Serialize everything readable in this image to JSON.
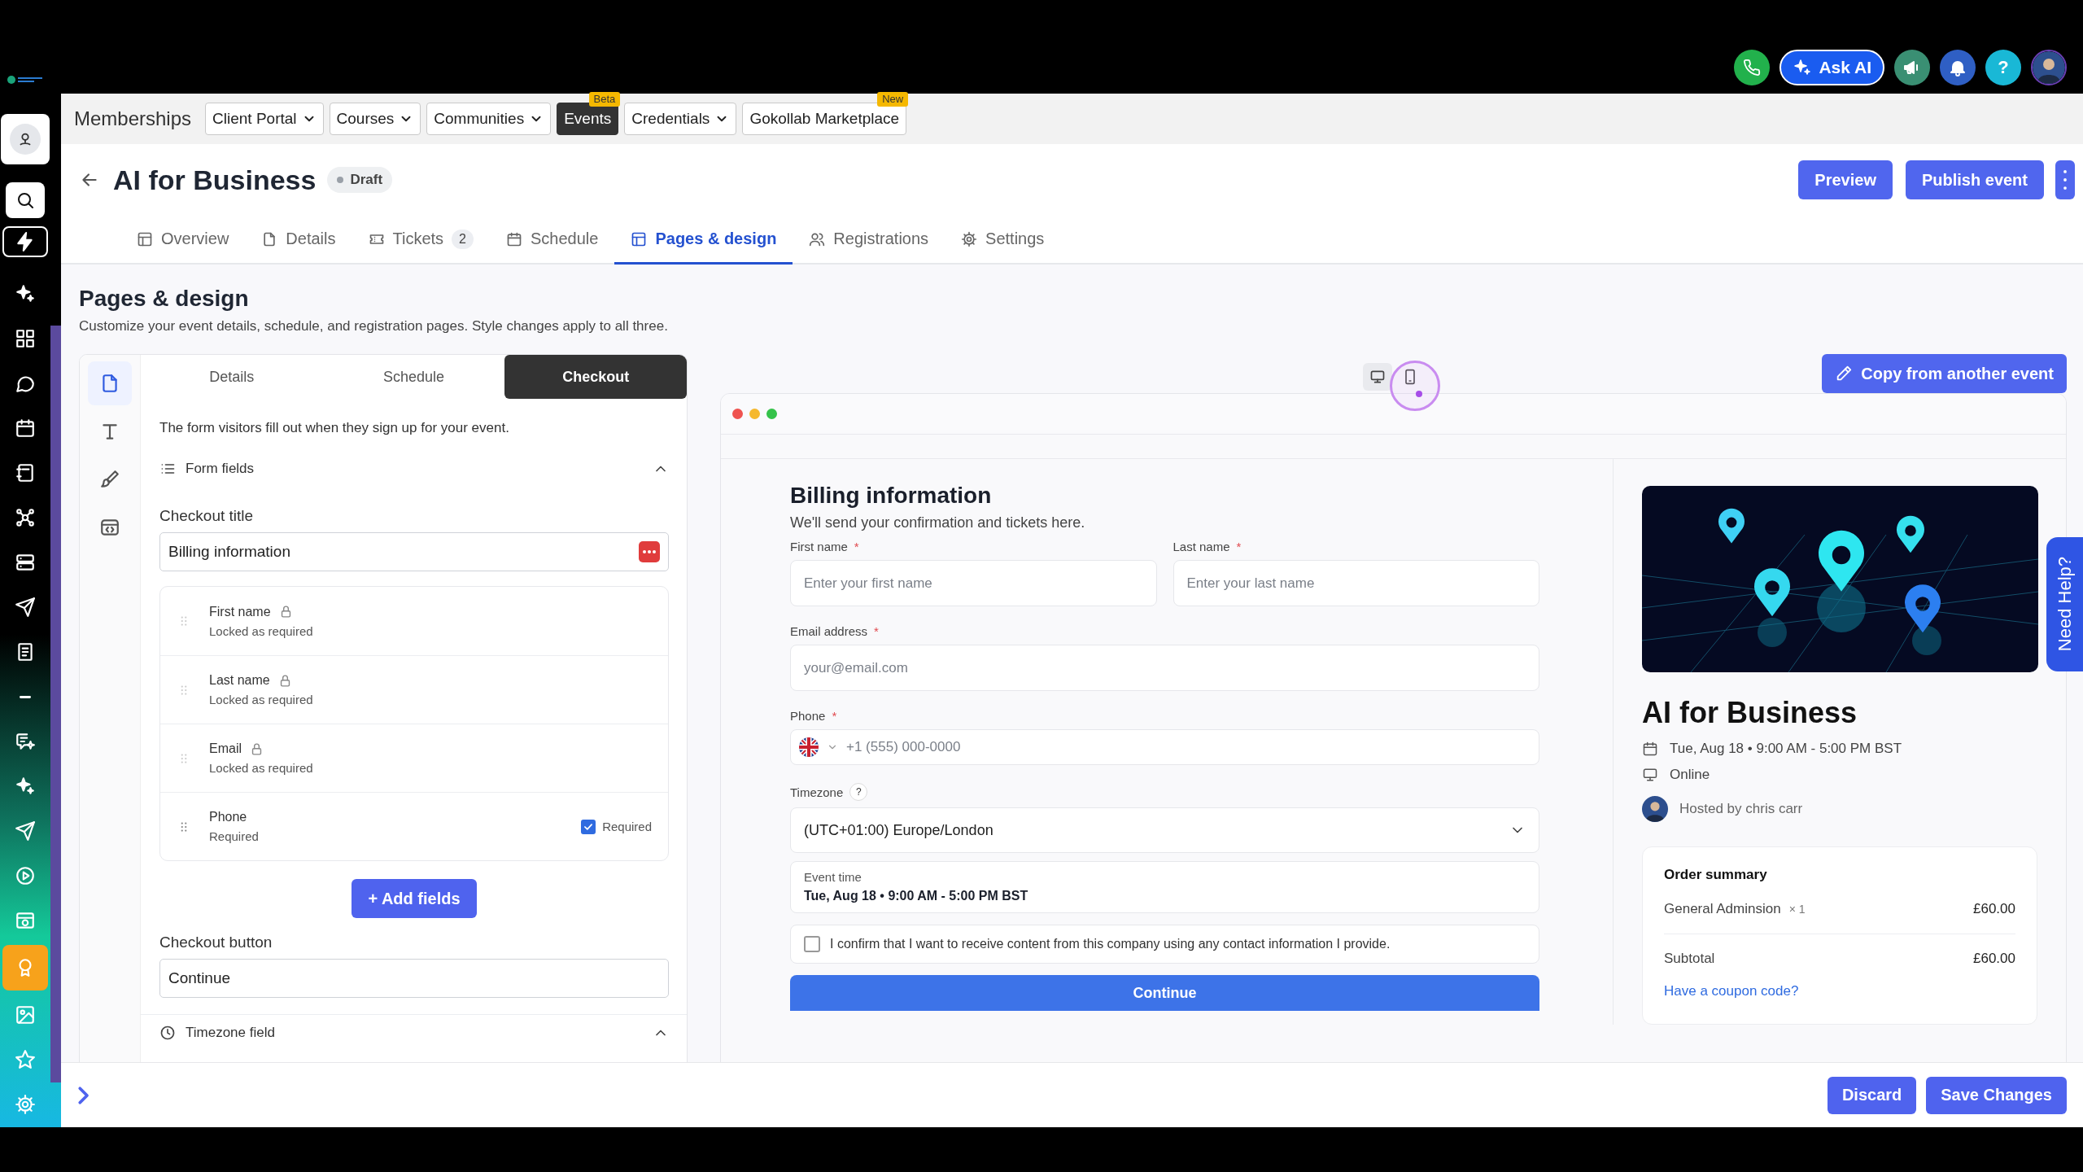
{
  "top_bar": {
    "ask_ai": "Ask AI",
    "help": "?"
  },
  "rail": [
    {
      "selected": false
    },
    {
      "selected": false
    },
    {
      "selected": false
    },
    {
      "selected": false
    },
    {
      "selected": false
    },
    {
      "selected": false
    },
    {
      "selected": false
    },
    {
      "selected": false
    },
    {
      "selected": false
    },
    {
      "selected": false
    },
    {
      "selected": false
    },
    {
      "selected": false
    },
    {
      "selected": false
    },
    {
      "selected": false
    },
    {
      "selected": false
    },
    {
      "selected": false
    },
    {
      "selected": false
    },
    {
      "selected": false
    },
    {
      "selected": true
    },
    {
      "selected": false
    },
    {
      "selected": false
    },
    {
      "selected": false
    }
  ],
  "nav": {
    "title": "Memberships",
    "items": [
      {
        "label": "Client Portal",
        "dropdown": true,
        "selected": false
      },
      {
        "label": "Courses",
        "dropdown": true,
        "selected": false
      },
      {
        "label": "Communities",
        "dropdown": true,
        "selected": false
      },
      {
        "label": "Events",
        "dropdown": false,
        "selected": true,
        "badge": "Beta"
      },
      {
        "label": "Credentials",
        "dropdown": true,
        "selected": false
      },
      {
        "label": "Gokollab Marketplace",
        "dropdown": false,
        "selected": false,
        "badge": "New"
      }
    ]
  },
  "event": {
    "title": "AI for Business",
    "status": "Draft",
    "actions": [
      "Preview",
      "Publish event"
    ]
  },
  "tabs": [
    {
      "label": "Overview",
      "selected": false
    },
    {
      "label": "Details",
      "selected": false
    },
    {
      "label": "Tickets",
      "count": "2",
      "selected": false
    },
    {
      "label": "Schedule",
      "selected": false
    },
    {
      "label": "Pages & design",
      "selected": true
    },
    {
      "label": "Registrations",
      "selected": false
    },
    {
      "label": "Settings",
      "selected": false
    }
  ],
  "section": {
    "title": "Pages & design",
    "subtitle": "Customize your event details, schedule, and registration pages. Style changes apply to all three."
  },
  "editor": {
    "tools": [
      {
        "selected": true
      },
      {
        "selected": false
      },
      {
        "selected": false
      },
      {
        "selected": false
      }
    ],
    "tabs": [
      {
        "label": "Details",
        "selected": false
      },
      {
        "label": "Schedule",
        "selected": false
      },
      {
        "label": "Checkout",
        "selected": true
      }
    ],
    "intro": "The form visitors fill out when they sign up for your event.",
    "form_fields": {
      "title": "Form fields",
      "expanded": true
    },
    "checkout_title": {
      "label": "Checkout title",
      "value": "Billing information"
    },
    "fields": [
      {
        "name": "First name",
        "note": "Locked as required",
        "locked": true
      },
      {
        "name": "Last name",
        "note": "Locked as required",
        "locked": true
      },
      {
        "name": "Email",
        "note": "Locked as required",
        "locked": true
      },
      {
        "name": "Phone",
        "note": "Required",
        "locked": false,
        "required": true,
        "required_label": "Required"
      }
    ],
    "add_fields": "+ Add fields",
    "checkout_button": {
      "label": "Checkout button",
      "value": "Continue"
    },
    "timezone_field": {
      "title": "Timezone field",
      "expanded": true
    }
  },
  "preview": {
    "devices": [
      {
        "selected": true
      },
      {
        "selected": false
      }
    ],
    "copy_button": "Copy from another event",
    "form": {
      "title": "Billing information",
      "subtitle": "We'll send your confirmation and tickets here.",
      "first_name": {
        "label": "First name",
        "required_mark": "*",
        "placeholder": "Enter your first name"
      },
      "last_name": {
        "label": "Last name",
        "required_mark": "*",
        "placeholder": "Enter your last name"
      },
      "email": {
        "label": "Email address",
        "required_mark": "*",
        "placeholder": "your@email.com"
      },
      "phone": {
        "label": "Phone",
        "required_mark": "*",
        "placeholder": "+1 (555) 000-0000"
      },
      "timezone": {
        "label": "Timezone",
        "hint": "?",
        "value": "(UTC+01:00) Europe/London"
      },
      "event_time": {
        "label": "Event time",
        "value": "Tue, Aug 18 • 9:00 AM - 5:00 PM BST"
      },
      "consent": {
        "label": "I confirm that I want to receive content from this company using any contact information I provide.",
        "checked": false
      },
      "submit": "Continue"
    },
    "summary": {
      "title": "AI for Business",
      "date": "Tue, Aug 18 • 9:00 AM - 5:00 PM BST",
      "location": "Online",
      "host": "Hosted by chris carr",
      "order": {
        "title": "Order summary",
        "items": [
          {
            "name": "General Adminsion",
            "quantity": "× 1",
            "price": "£60.00"
          }
        ],
        "subtotal_label": "Subtotal",
        "subtotal": "£60.00",
        "coupon": "Have a coupon code?"
      }
    }
  },
  "need_help": "Need Help?",
  "footer": {
    "discard": "Discard",
    "save": "Save Changes"
  }
}
